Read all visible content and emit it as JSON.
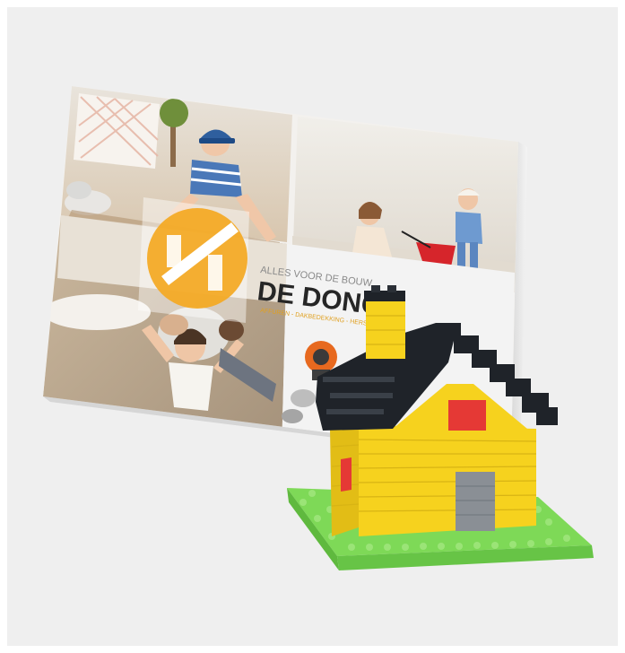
{
  "scene": {
    "background_color": "#efefef",
    "tagline": "ALLES VOOR DE BOUW",
    "brand": "DE DONCK",
    "subline": "AFFUREN - DAKBEDEKKING - HERSTEL",
    "logo_color": "#f4a922",
    "house": {
      "wall_color": "#f6d21e",
      "roof_color": "#1f2329",
      "door_color": "#8a8f95",
      "window_color": "#e53935",
      "base_color": "#7ed957"
    }
  }
}
